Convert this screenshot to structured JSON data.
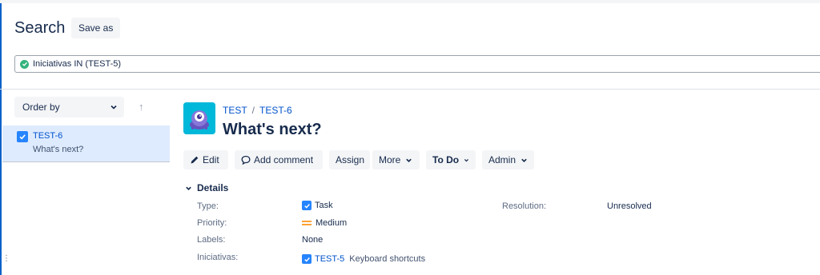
{
  "header": {
    "title": "Search",
    "save_as_label": "Save as"
  },
  "jql": {
    "query": "Iniciativas IN (TEST-5)",
    "status_icon": "check-circle-icon",
    "status_color": "#36b37e"
  },
  "sidebar": {
    "order_by_label": "Order by",
    "sort_icon": "arrow-up-icon",
    "items": [
      {
        "key": "TEST-6",
        "summary": "What's next?",
        "type_icon": "task-icon"
      }
    ]
  },
  "issue": {
    "breadcrumb": {
      "project": "TEST",
      "separator": "/",
      "key": "TEST-6"
    },
    "title": "What's next?",
    "avatar_icon": "project-avatar-icon",
    "toolbar": {
      "edit": "Edit",
      "comment": "Add comment",
      "assign": "Assign",
      "more": "More",
      "status": "To Do",
      "admin": "Admin"
    },
    "details": {
      "header": "Details",
      "type_label": "Type:",
      "type_value": "Task",
      "priority_label": "Priority:",
      "priority_value": "Medium",
      "priority_color": "#ff991f",
      "labels_label": "Labels:",
      "labels_value": "None",
      "iniciativas_label": "Iniciativas:",
      "iniciativas_key": "TEST-5",
      "iniciativas_summary": "Keyboard shortcuts",
      "resolution_label": "Resolution:",
      "resolution_value": "Unresolved"
    }
  },
  "colors": {
    "accent": "#0052cc",
    "selected_bg": "#deebff",
    "button_bg": "#f4f5f7"
  }
}
